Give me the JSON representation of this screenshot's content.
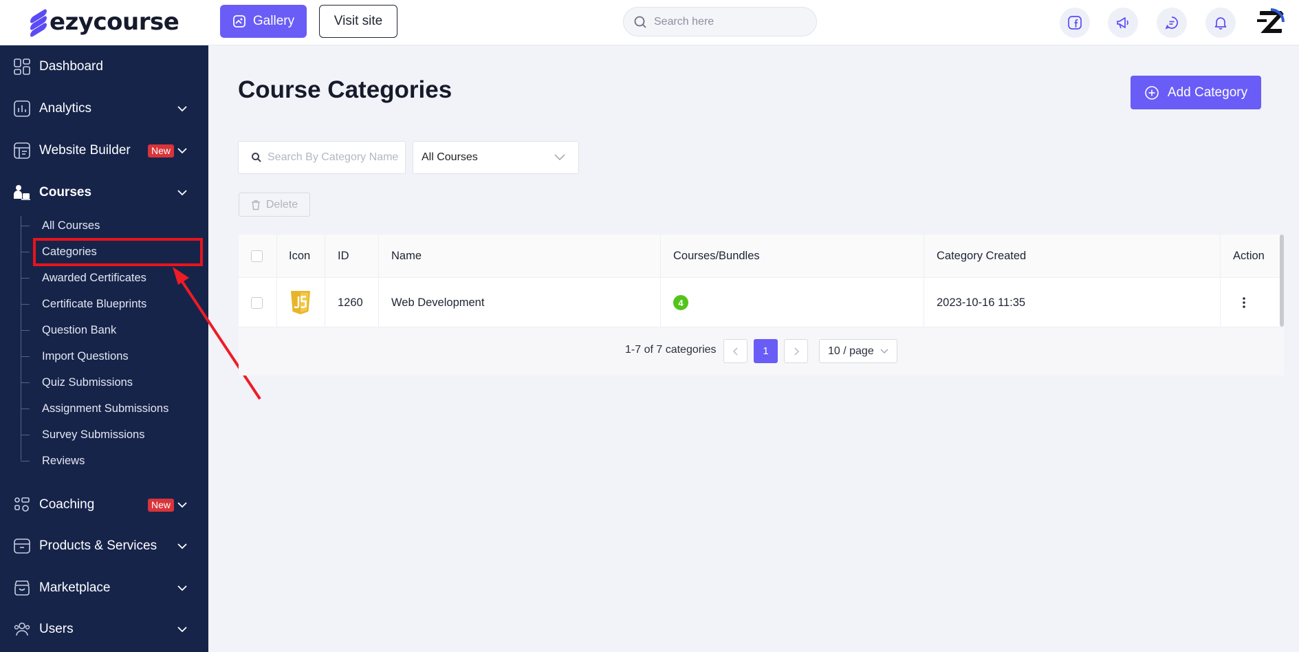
{
  "brand": {
    "logo_text": "ezycourse",
    "accent": "#6a5cf6",
    "sidebar_bg": "#16244a"
  },
  "header": {
    "gallery_label": "Gallery",
    "visit_site_label": "Visit site",
    "search_placeholder": "Search here",
    "icons": [
      "facebook-icon",
      "megaphone-icon",
      "chat-icon",
      "bell-icon",
      "avatar"
    ]
  },
  "sidebar": {
    "items": [
      {
        "label": "Dashboard",
        "icon": "grid-icon"
      },
      {
        "label": "Analytics",
        "icon": "chart-icon"
      },
      {
        "label": "Website Builder",
        "icon": "layout-icon",
        "badge": "New"
      },
      {
        "label": "Courses",
        "icon": "courses-icon"
      },
      {
        "label": "Coaching",
        "icon": "coaching-icon",
        "badge": "New"
      },
      {
        "label": "Products & Services",
        "icon": "box-icon"
      },
      {
        "label": "Marketplace",
        "icon": "store-icon"
      },
      {
        "label": "Users",
        "icon": "users-icon"
      }
    ],
    "courses_sub": [
      "All Courses",
      "Categories",
      "Awarded Certificates",
      "Certificate Blueprints",
      "Question Bank",
      "Import Questions",
      "Quiz Submissions",
      "Assignment Submissions",
      "Survey Submissions",
      "Reviews"
    ]
  },
  "main": {
    "title": "Course Categories",
    "add_button": "Add Category",
    "search_placeholder": "Search By Category Name",
    "filter_value": "All Courses",
    "delete_label": "Delete",
    "table": {
      "columns": [
        "Icon",
        "ID",
        "Name",
        "Courses/Bundles",
        "Category Created",
        "Action"
      ],
      "rows": [
        {
          "icon": "js-icon",
          "id": "1260",
          "name": "Web Development",
          "count": "4",
          "created": "2023-10-16 11:35"
        }
      ]
    },
    "pagination": {
      "summary": "1-7 of 7 categories",
      "current_page": "1",
      "page_size": "10 / page"
    }
  }
}
